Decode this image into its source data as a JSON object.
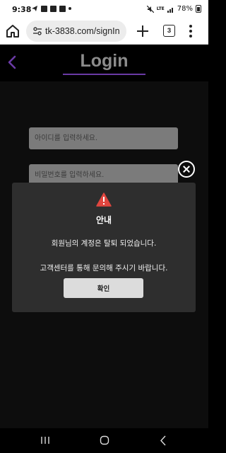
{
  "status_bar": {
    "time": "9:38",
    "lte_label": "LTE",
    "battery": "78%",
    "icons": [
      "telegram-icon",
      "image-icon",
      "message-icon",
      "check-icon",
      "mute-icon",
      "volte-icon",
      "signal-icon",
      "battery-icon"
    ]
  },
  "browser": {
    "url": "tk-3838.com/signIn",
    "tab_count": "3"
  },
  "header": {
    "title": "Login"
  },
  "form": {
    "id_placeholder": "아이디를 입력하세요.",
    "pw_placeholder": "비밀번호를 입력하세요."
  },
  "modal": {
    "title": "안내",
    "message1": "회원님의 계정은 탈퇴 되었습니다.",
    "message2": "고객센터를 통해 문의해 주시기 바랍니다.",
    "confirm_label": "확인"
  },
  "colors": {
    "accent": "#6a3aa5",
    "warning": "#e0463f",
    "modal_bg": "#2e2e2e",
    "input_bg": "#7b7b7b"
  }
}
